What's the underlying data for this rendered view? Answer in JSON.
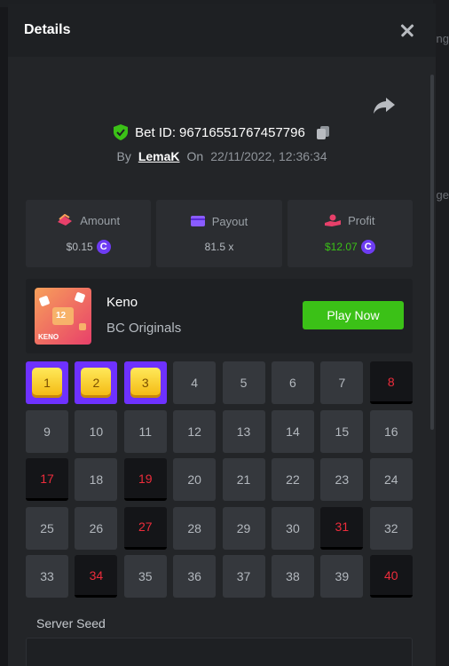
{
  "background": {
    "right_text_1": "ng",
    "right_text_2": "ge"
  },
  "modal": {
    "title": "Details"
  },
  "bet": {
    "label": "Bet ID:",
    "id": "96716551767457796",
    "by_label": "By",
    "user": "LemaK",
    "on_label": "On",
    "date": "22/11/2022, 12:36:34"
  },
  "stats": {
    "amount": {
      "label": "Amount",
      "value": "$0.15",
      "icon": "money-icon"
    },
    "payout": {
      "label": "Payout",
      "value": "81.5 x",
      "icon": "wallet-icon"
    },
    "profit": {
      "label": "Profit",
      "value": "$12.07",
      "icon": "hand-coins-icon"
    },
    "coin_symbol": "C"
  },
  "game": {
    "name": "Keno",
    "provider": "BC Originals",
    "play_label": "Play Now",
    "thumb_label": "KENO",
    "thumb_badge": "12"
  },
  "grid": {
    "tiles": [
      {
        "n": "1",
        "state": "picked"
      },
      {
        "n": "2",
        "state": "picked"
      },
      {
        "n": "3",
        "state": "picked"
      },
      {
        "n": "4",
        "state": "normal"
      },
      {
        "n": "5",
        "state": "normal"
      },
      {
        "n": "6",
        "state": "normal"
      },
      {
        "n": "7",
        "state": "normal"
      },
      {
        "n": "8",
        "state": "hit"
      },
      {
        "n": "9",
        "state": "normal"
      },
      {
        "n": "10",
        "state": "normal"
      },
      {
        "n": "11",
        "state": "normal"
      },
      {
        "n": "12",
        "state": "normal"
      },
      {
        "n": "13",
        "state": "normal"
      },
      {
        "n": "14",
        "state": "normal"
      },
      {
        "n": "15",
        "state": "normal"
      },
      {
        "n": "16",
        "state": "normal"
      },
      {
        "n": "17",
        "state": "hit"
      },
      {
        "n": "18",
        "state": "normal"
      },
      {
        "n": "19",
        "state": "hit"
      },
      {
        "n": "20",
        "state": "normal"
      },
      {
        "n": "21",
        "state": "normal"
      },
      {
        "n": "22",
        "state": "normal"
      },
      {
        "n": "23",
        "state": "normal"
      },
      {
        "n": "24",
        "state": "normal"
      },
      {
        "n": "25",
        "state": "normal"
      },
      {
        "n": "26",
        "state": "normal"
      },
      {
        "n": "27",
        "state": "hit"
      },
      {
        "n": "28",
        "state": "normal"
      },
      {
        "n": "29",
        "state": "normal"
      },
      {
        "n": "30",
        "state": "normal"
      },
      {
        "n": "31",
        "state": "hit"
      },
      {
        "n": "32",
        "state": "normal"
      },
      {
        "n": "33",
        "state": "normal"
      },
      {
        "n": "34",
        "state": "hit"
      },
      {
        "n": "35",
        "state": "normal"
      },
      {
        "n": "36",
        "state": "normal"
      },
      {
        "n": "37",
        "state": "normal"
      },
      {
        "n": "38",
        "state": "normal"
      },
      {
        "n": "39",
        "state": "normal"
      },
      {
        "n": "40",
        "state": "hit"
      }
    ]
  },
  "seed": {
    "label": "Server Seed"
  },
  "colors": {
    "accent_purple": "#6e31ff",
    "play_green": "#3bc117",
    "hit_red": "#ed2c3b",
    "gem_yellow": "#f3b70f"
  }
}
